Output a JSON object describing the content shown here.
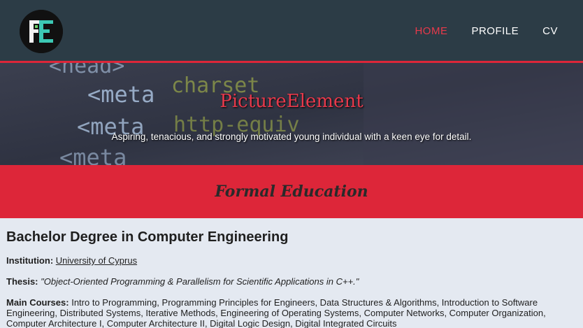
{
  "nav": {
    "links": [
      {
        "label": "HOME"
      },
      {
        "label": "PROFILE"
      },
      {
        "label": "CV"
      }
    ],
    "accent_color": "#e8394b",
    "bar_color": "#2c3c46"
  },
  "hero": {
    "title": "PictureElement",
    "subtitle": "Aspiring, tenacious, and strongly motivated young individual with a keen eye for detail.",
    "code_lines": [
      "<head>",
      "<meta",
      "charset",
      "<meta",
      "http-equiv",
      "<meta"
    ]
  },
  "section": {
    "title": "Formal Education",
    "band_color": "#dd2639"
  },
  "education": {
    "degree": "Bachelor Degree in Computer Engineering",
    "institution_label": "Institution:",
    "institution": "University of Cyprus",
    "thesis_label": "Thesis:",
    "thesis": "\"Object-Oriented Programming & Parallelism for Scientific Applications in C++.\"",
    "courses_label": "Main Courses:",
    "courses": "Intro to Programming, Programming Principles for Engineers, Data Structures & Algorithms, Introduction to Software Engineering, Distributed Systems, Iterative Methods, Engineering of Operating Systems, Computer Networks, Computer Organization, Computer Architecture I, Computer Architecture II, Digital Logic Design, Digital Integrated Circuits"
  }
}
